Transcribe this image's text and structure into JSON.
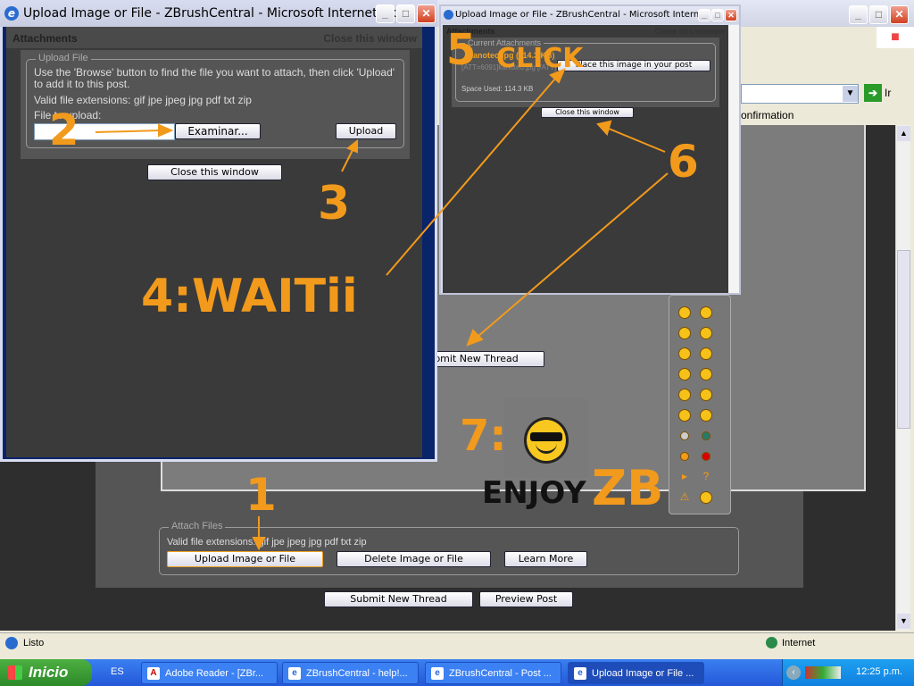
{
  "main_window": {
    "go_label": "Ir",
    "links_text": "onfirmation",
    "status_text": "Listo",
    "zone_text": "Internet"
  },
  "popup_left": {
    "title": "Upload Image or File - ZBrushCentral - Microsoft Internet Ex...",
    "header": "Attachments",
    "close_link": "Close this window",
    "legend": "Upload File",
    "instructions": "Use the 'Browse' button to find the file you want to attach, then click 'Upload' to add it to this post.",
    "extensions": "Valid file extensions: gif jpe jpeg jpg pdf txt zip",
    "file_label": "File to upload:",
    "file_value": "",
    "browse_button": "Examinar...",
    "upload_button": "Upload",
    "close_button": "Close this window"
  },
  "popup_right": {
    "title": "Upload Image or File - ZBrushCentral - Microsoft Internet Ex...",
    "header": "Attachments",
    "close_link": "Close this window",
    "legend": "Current Attachments",
    "file_name": "kanoteo.jpg (114.3 KB)",
    "att_code": "[ATT=6091]kanoteo.jpg [/ATT]",
    "space_used": "Space Used: 114.3 KB",
    "place_button": "Place this image in your post",
    "close_button": "Close this window"
  },
  "page": {
    "submit_mid": "Submit New Thread",
    "attach_legend": "Attach Files",
    "attach_extensions": "Valid file extensions: gif jpe jpeg jpg pdf txt zip",
    "upload_button": "Upload Image or File",
    "delete_button": "Delete Image or File",
    "learn_button": "Learn More",
    "submit_button": "Submit New Thread",
    "preview_button": "Preview Post",
    "smilies": [
      "frown",
      "eek",
      "biggrin",
      "rolleyes",
      "cool",
      "confused",
      "thumbs-up",
      "thumbs-down",
      "smile",
      "neutral",
      "mad",
      "worried",
      "grey-dot",
      "green-dot",
      "orange-dot",
      "red-dot",
      "arrow",
      "question",
      "warning",
      "shocked"
    ]
  },
  "annotations": {
    "a1": "1",
    "a2": "2",
    "a3": "3",
    "a4": "4:WAITii",
    "a5": "5",
    "a5b": "CLICK",
    "a6": "6",
    "a7": "7:",
    "enjoy": "ENJOY",
    "zb": "ZB"
  },
  "taskbar": {
    "start": "Inicio",
    "lang": "ES",
    "tasks": [
      "Adobe Reader - [ZBr...",
      "ZBrushCentral - help!...",
      "ZBrushCentral - Post ...",
      "Upload Image or File ..."
    ],
    "clock": "12:25 p.m."
  },
  "colors": {
    "accent": "#f29a1c",
    "content_bg": "#3a3a3a",
    "xp_blue": "#245edb"
  }
}
